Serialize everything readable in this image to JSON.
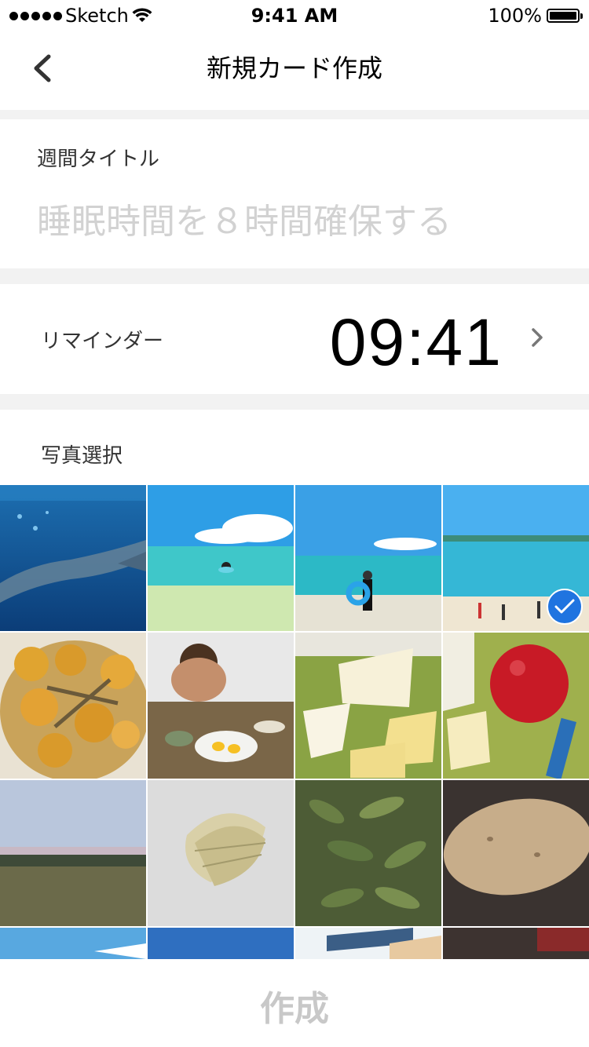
{
  "status_bar": {
    "carrier": "Sketch",
    "time": "9:41 AM",
    "battery": "100%",
    "battery_level": 1.0
  },
  "nav": {
    "title": "新規カード作成",
    "back_icon": "chevron-left-icon"
  },
  "weekly_title": {
    "label": "週間タイトル",
    "placeholder": "睡眠時間を８時間確保する",
    "value": ""
  },
  "reminder": {
    "label": "リマインダー",
    "time": "09:41",
    "chevron_icon": "chevron-right-icon"
  },
  "photos": {
    "label": "写真選択",
    "items": [
      {
        "name": "photo-aquarium-whale-shark",
        "selected": false
      },
      {
        "name": "photo-beach-swimmer",
        "selected": false
      },
      {
        "name": "photo-beach-person-float",
        "selected": false
      },
      {
        "name": "photo-beach-people",
        "selected": true
      },
      {
        "name": "photo-potatoes-fish",
        "selected": false
      },
      {
        "name": "photo-person-breakfast",
        "selected": false
      },
      {
        "name": "photo-cheese-plate",
        "selected": false
      },
      {
        "name": "photo-apple-cheese",
        "selected": false
      },
      {
        "name": "photo-field-landscape",
        "selected": false
      },
      {
        "name": "photo-dried-leaves",
        "selected": false
      },
      {
        "name": "photo-edamame",
        "selected": false
      },
      {
        "name": "photo-potato",
        "selected": false
      },
      {
        "name": "photo-sky-partial",
        "selected": false
      },
      {
        "name": "photo-blue-partial",
        "selected": false
      },
      {
        "name": "photo-structure-partial",
        "selected": false
      },
      {
        "name": "photo-dark-partial",
        "selected": false
      }
    ],
    "selected_check_icon": "checkmark-icon",
    "accent_color": "#1f74e0"
  },
  "create_button": {
    "label": "作成",
    "disabled": true
  }
}
